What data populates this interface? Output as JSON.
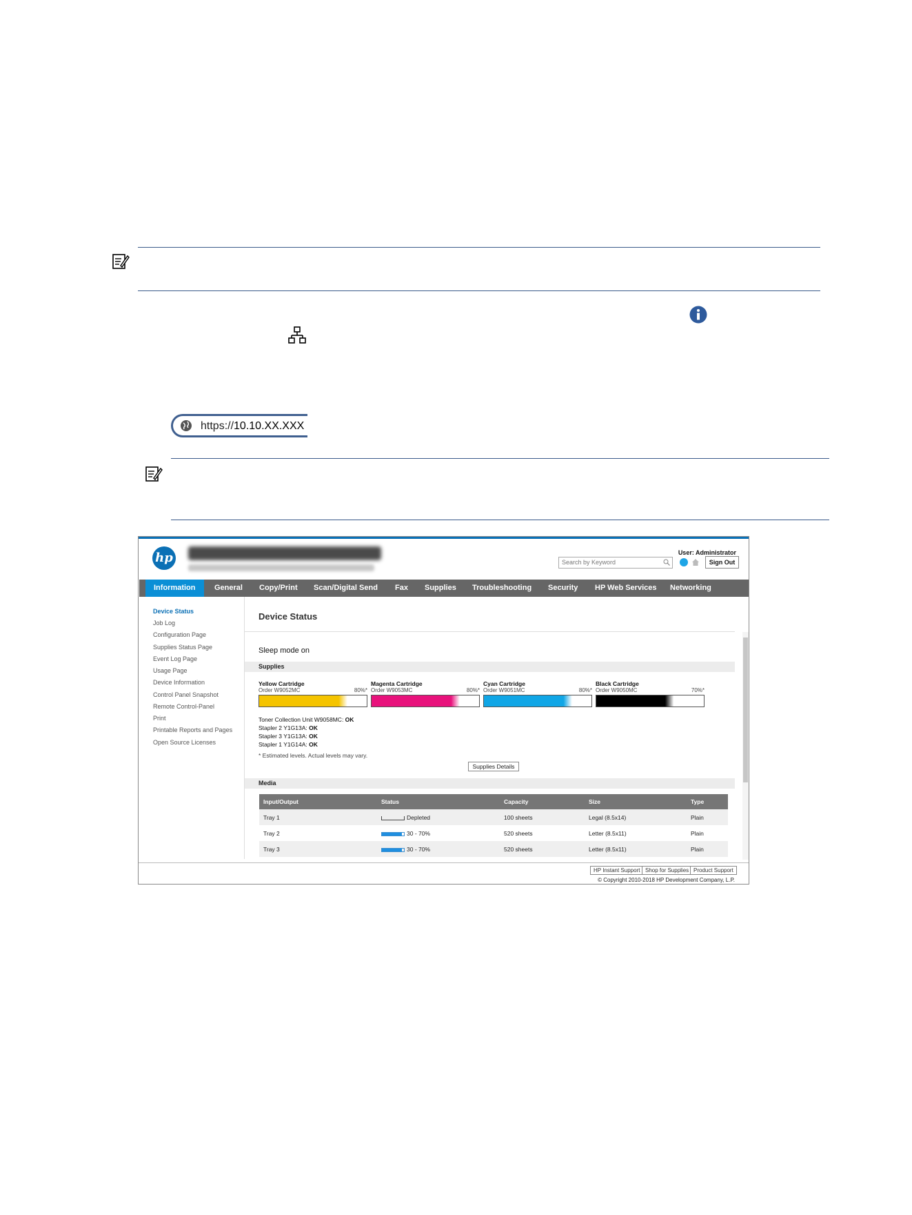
{
  "url_bar": {
    "prefix": "https://",
    "address": "10.10.XX.XXX"
  },
  "ews": {
    "logo_text": "hp",
    "user_label": "User: Administrator",
    "search_placeholder": "Search by Keyword",
    "signout_label": "Sign Out",
    "nav": [
      "Information",
      "General",
      "Copy/Print",
      "Scan/Digital Send",
      "Fax",
      "Supplies",
      "Troubleshooting",
      "Security",
      "HP Web Services",
      "Networking"
    ],
    "sidebar": [
      "Device Status",
      "Job Log",
      "Configuration Page",
      "Supplies Status Page",
      "Event Log Page",
      "Usage Page",
      "Device Information",
      "Control Panel Snapshot",
      "Remote Control-Panel",
      "Print",
      "Printable Reports and Pages",
      "Open Source Licenses"
    ],
    "page_title": "Device Status",
    "sleep_text": "Sleep mode on",
    "supplies_label": "Supplies",
    "cartridges": [
      {
        "name": "Yellow Cartridge",
        "order": "Order W9052MC",
        "pct": "80%*",
        "level": 0.8,
        "color": "#f5c400"
      },
      {
        "name": "Magenta Cartridge",
        "order": "Order W9053MC",
        "pct": "80%*",
        "level": 0.8,
        "color": "#e8127c"
      },
      {
        "name": "Cyan Cartridge",
        "order": "Order W9051MC",
        "pct": "80%*",
        "level": 0.8,
        "color": "#10a6e6"
      },
      {
        "name": "Black Cartridge",
        "order": "Order W9050MC",
        "pct": "70%*",
        "level": 0.7,
        "color": "#000000"
      }
    ],
    "statuses": [
      {
        "label": "Toner Collection Unit W9058MC: ",
        "value": "OK"
      },
      {
        "label": "Stapler 2 Y1G13A: ",
        "value": "OK"
      },
      {
        "label": "Stapler 3 Y1G13A: ",
        "value": "OK"
      },
      {
        "label": "Stapler 1 Y1G14A: ",
        "value": "OK"
      }
    ],
    "estimate_note": "* Estimated levels. Actual levels may vary.",
    "supplies_details_label": "Supplies Details",
    "media_label": "Media",
    "media_headers": [
      "Input/Output",
      "Status",
      "Capacity",
      "Size",
      "Type"
    ],
    "media_rows": [
      {
        "io": "Tray 1",
        "status": "Depleted",
        "level": 0,
        "capacity": "100 sheets",
        "size": "Legal (8.5x14)",
        "type": "Plain"
      },
      {
        "io": "Tray 2",
        "status": "30 - 70%",
        "level": 0.9,
        "capacity": "520 sheets",
        "size": "Letter (8.5x11)",
        "type": "Plain"
      },
      {
        "io": "Tray 3",
        "status": "30 - 70%",
        "level": 0.9,
        "capacity": "520 sheets",
        "size": "Letter (8.5x11)",
        "type": "Plain"
      }
    ],
    "footer_buttons": [
      "HP Instant Support",
      "Shop for Supplies",
      "Product Support"
    ],
    "copyright": "© Copyright 2010-2018 HP Development Company, L.P."
  }
}
